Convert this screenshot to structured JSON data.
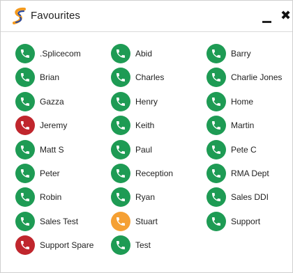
{
  "window": {
    "title": "Favourites",
    "minimize_icon": "minimize-icon",
    "close_icon": "close-icon",
    "close_glyph": "✖"
  },
  "colors": {
    "green": "#1e9b54",
    "red": "#c0262d",
    "orange": "#f5a033"
  },
  "contacts": [
    {
      "name": ".Splicecom",
      "status": "green"
    },
    {
      "name": "Abid",
      "status": "green"
    },
    {
      "name": "Barry",
      "status": "green"
    },
    {
      "name": "Brian",
      "status": "green"
    },
    {
      "name": "Charles",
      "status": "green"
    },
    {
      "name": "Charlie Jones",
      "status": "green"
    },
    {
      "name": "Gazza",
      "status": "green"
    },
    {
      "name": "Henry",
      "status": "green"
    },
    {
      "name": "Home",
      "status": "green"
    },
    {
      "name": "Jeremy",
      "status": "red"
    },
    {
      "name": "Keith",
      "status": "green"
    },
    {
      "name": "Martin",
      "status": "green"
    },
    {
      "name": "Matt S",
      "status": "green"
    },
    {
      "name": "Paul",
      "status": "green"
    },
    {
      "name": "Pete C",
      "status": "green"
    },
    {
      "name": "Peter",
      "status": "green"
    },
    {
      "name": "Reception",
      "status": "green"
    },
    {
      "name": "RMA Dept",
      "status": "green"
    },
    {
      "name": "Robin",
      "status": "green"
    },
    {
      "name": "Ryan",
      "status": "green"
    },
    {
      "name": "Sales DDI",
      "status": "green"
    },
    {
      "name": "Sales Test",
      "status": "green"
    },
    {
      "name": "Stuart",
      "status": "orange"
    },
    {
      "name": "Support",
      "status": "green"
    },
    {
      "name": "Support Spare",
      "status": "red"
    },
    {
      "name": "Test",
      "status": "green"
    }
  ]
}
